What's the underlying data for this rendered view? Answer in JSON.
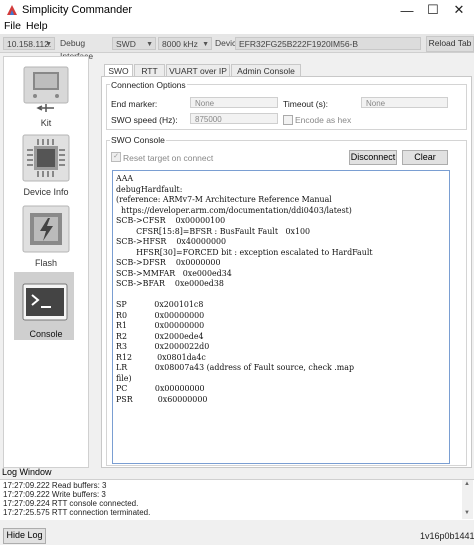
{
  "window": {
    "title": "Simplicity Commander",
    "min": "—",
    "max": "☐",
    "close": "✕"
  },
  "menu": [
    "File",
    "Help"
  ],
  "toolbar": {
    "adapter_ip": "10.158.112.",
    "debug_interface_label": "Debug Interface",
    "debug_interface_value": "SWD",
    "speed": "8000 kHz",
    "device_label": "Device",
    "device_value": "EFR32FG25B222F1920IM56-B",
    "reload_tab": "Reload Tab"
  },
  "nav": [
    {
      "label": "Kit",
      "icon": "kit-icon"
    },
    {
      "label": "Device Info",
      "icon": "chip-icon"
    },
    {
      "label": "Flash",
      "icon": "flash-icon"
    },
    {
      "label": "Console",
      "icon": "console-icon",
      "selected": true
    }
  ],
  "tabs": [
    "SWO",
    "RTT",
    "VUART over IP",
    "Admin Console"
  ],
  "connection_options": {
    "title": "Connection Options",
    "end_marker_label": "End marker:",
    "end_marker_value": "None",
    "timeout_label": "Timeout (s):",
    "timeout_value": "None",
    "swo_speed_label": "SWO speed (Hz):",
    "swo_speed_value": "875000",
    "encode_hex_label": "Encode as hex"
  },
  "swo_console": {
    "title": "SWO Console",
    "reset_label": "Reset target on connect",
    "disconnect": "Disconnect",
    "clear": "Clear",
    "output": "AAA\ndebugHardfault:\n(reference: ARMv7-M Architecture Reference Manual\n  https://developer.arm.com/documentation/ddi0403/latest)\nSCB->CFSR    0x00000100\n        CFSR[15:8]=BFSR : BusFault Fault   0x100\nSCB->HFSR    0x40000000\n        HFSR[30]=FORCED bit : exception escalated to HardFault\nSCB->DFSR    0x0000000\nSCB->MMFAR   0xe000ed34\nSCB->BFAR    0xe000ed38\n\nSP           0x200101c8\nR0           0x00000000\nR1           0x00000000\nR2           0x2000ede4\nR3           0x2000022d0\nR12          0x0801da4c\nLR           0x08007a43 (address of Fault source, check .map\nfile)\nPC           0x00000000\nPSR          0x60000000"
  },
  "log": {
    "title": "Log Window",
    "lines": [
      "17:27:09.222 Read buffers:  3",
      "17:27:09.222 Write buffers: 3",
      "17:27:09.224 RTT console connected.",
      "17:27:25.575 RTT connection terminated."
    ]
  },
  "footer": {
    "hide_log": "Hide Log",
    "version": "1v16p0b1441"
  },
  "colors": {
    "accent": "#7a9ed2",
    "selected_nav": "#cfcfcf"
  }
}
